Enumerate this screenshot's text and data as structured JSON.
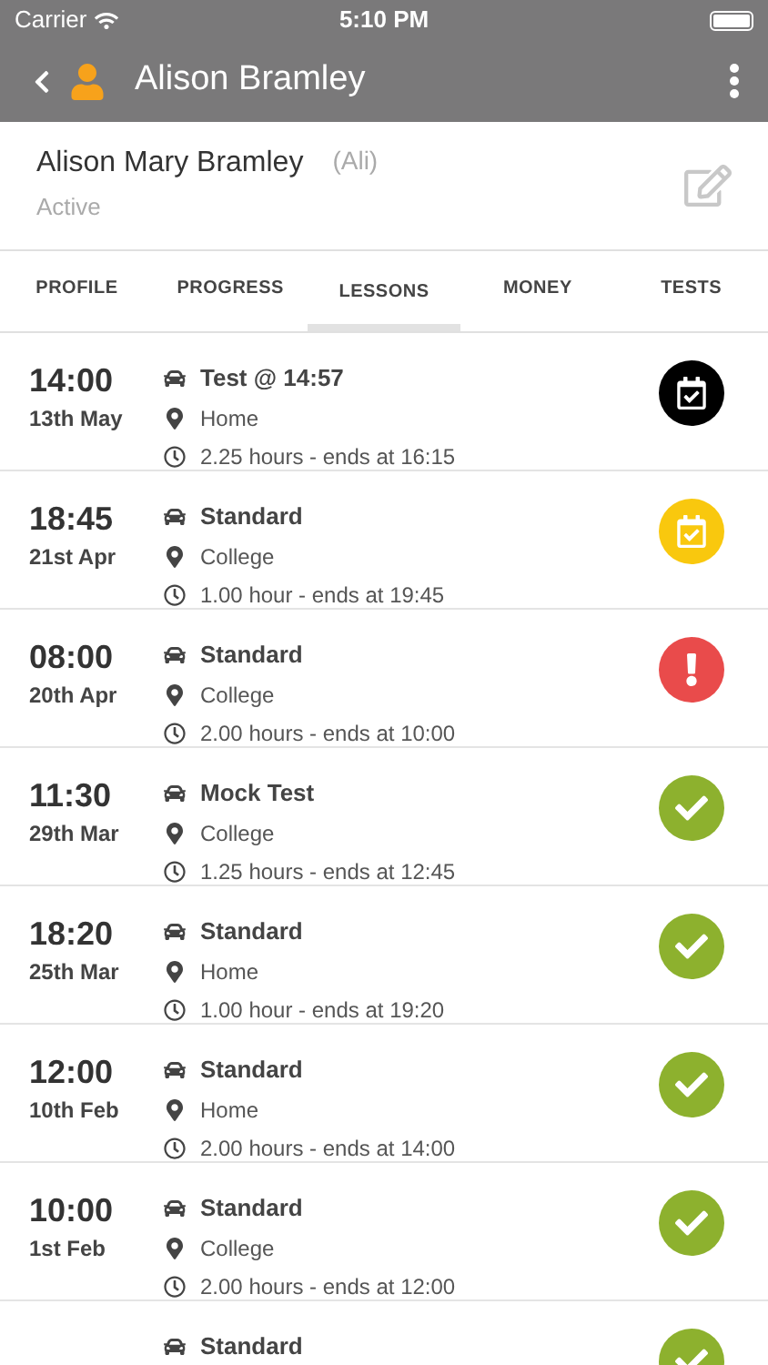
{
  "status_bar": {
    "carrier": "Carrier",
    "time": "5:10 PM"
  },
  "nav": {
    "title": "Alison Bramley"
  },
  "profile": {
    "name": "Alison Mary Bramley",
    "nickname": "(Ali)",
    "status": "Active"
  },
  "tabs": [
    {
      "label": "PROFILE",
      "selected": false
    },
    {
      "label": "PROGRESS",
      "selected": false
    },
    {
      "label": "LESSONS",
      "selected": true
    },
    {
      "label": "MONEY",
      "selected": false
    },
    {
      "label": "TESTS",
      "selected": false
    }
  ],
  "lessons": [
    {
      "time": "14:00",
      "date": "13th May",
      "type": "Test @ 14:57",
      "location": "Home",
      "duration": "2.25 hours - ends at 16:15",
      "kind": "test"
    },
    {
      "time": "18:45",
      "date": "21st Apr",
      "type": "Standard",
      "location": "College",
      "duration": "1.00 hour - ends at 19:45",
      "kind": "booked"
    },
    {
      "time": "08:00",
      "date": "20th Apr",
      "type": "Standard",
      "location": "College",
      "duration": "2.00 hours - ends at 10:00",
      "kind": "alert"
    },
    {
      "time": "11:30",
      "date": "29th Mar",
      "type": "Mock Test",
      "location": "College",
      "duration": "1.25 hours - ends at 12:45",
      "kind": "done"
    },
    {
      "time": "18:20",
      "date": "25th Mar",
      "type": "Standard",
      "location": "Home",
      "duration": "1.00 hour - ends at 19:20",
      "kind": "done"
    },
    {
      "time": "12:00",
      "date": "10th Feb",
      "type": "Standard",
      "location": "Home",
      "duration": "2.00 hours - ends at 14:00",
      "kind": "done"
    },
    {
      "time": "10:00",
      "date": "1st Feb",
      "type": "Standard",
      "location": "College",
      "duration": "2.00 hours - ends at 12:00",
      "kind": "done"
    },
    {
      "type": "Standard",
      "kind": "done"
    }
  ]
}
